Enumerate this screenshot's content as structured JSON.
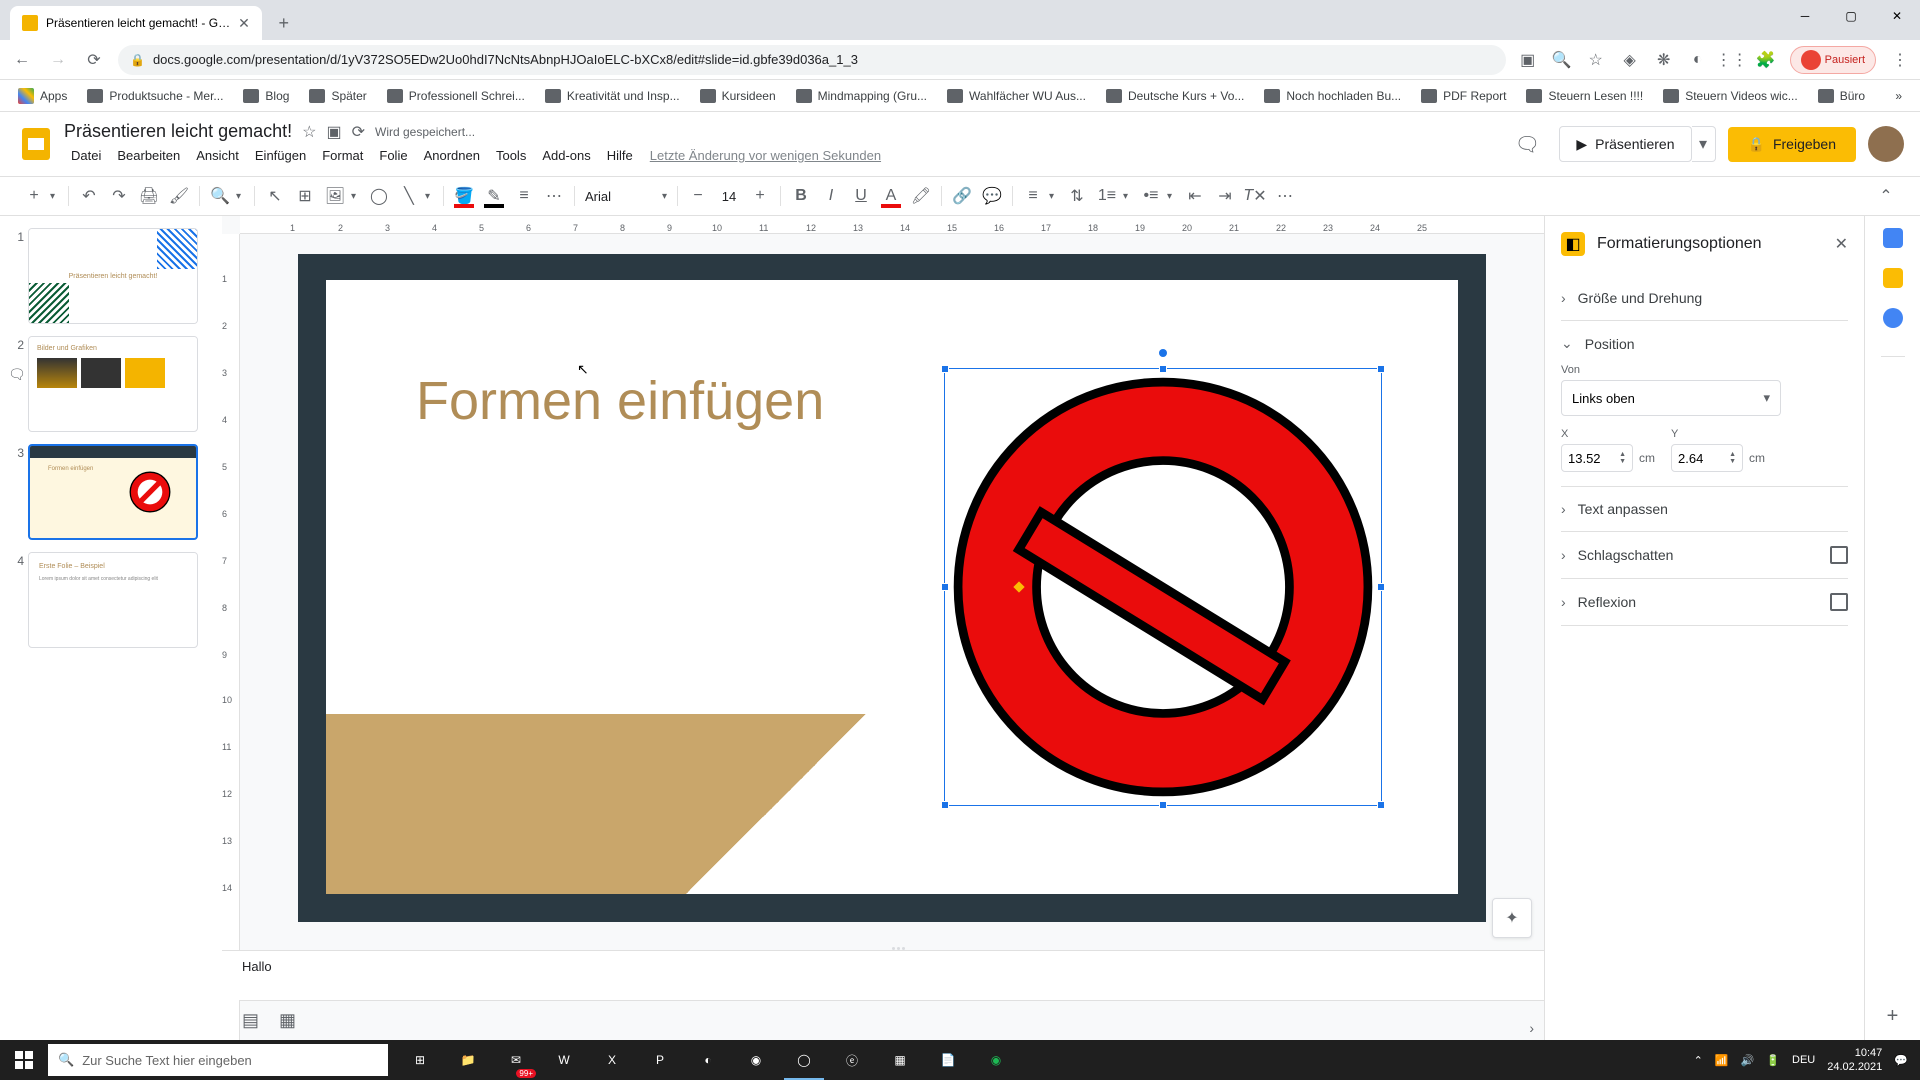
{
  "browser": {
    "tab_title": "Präsentieren leicht gemacht! - G…",
    "url": "docs.google.com/presentation/d/1yV372SO5EDw2Uo0hdI7NcNtsAbnpHJOaIoELC-bXCx8/edit#slide=id.gbfe39d036a_1_3",
    "paused": "Pausiert"
  },
  "bookmarks": [
    "Apps",
    "Produktsuche - Mer...",
    "Blog",
    "Später",
    "Professionell Schrei...",
    "Kreativität und Insp...",
    "Kursideen",
    "Mindmapping (Gru...",
    "Wahlfächer WU Aus...",
    "Deutsche Kurs + Vo...",
    "Noch hochladen Bu...",
    "PDF Report",
    "Steuern Lesen !!!!",
    "Steuern Videos wic...",
    "Büro"
  ],
  "doc": {
    "title": "Präsentieren leicht gemacht!",
    "saving": "Wird gespeichert...",
    "last_edit": "Letzte Änderung vor wenigen Sekunden"
  },
  "menu": [
    "Datei",
    "Bearbeiten",
    "Ansicht",
    "Einfügen",
    "Format",
    "Folie",
    "Anordnen",
    "Tools",
    "Add-ons",
    "Hilfe"
  ],
  "header": {
    "present": "Präsentieren",
    "share": "Freigeben"
  },
  "toolbar": {
    "font": "Arial",
    "font_size": "14"
  },
  "ruler_h": [
    "1",
    "2",
    "3",
    "4",
    "5",
    "6",
    "7",
    "8",
    "9",
    "10",
    "11",
    "12",
    "13",
    "14",
    "15",
    "16",
    "17",
    "18",
    "19",
    "20",
    "21",
    "22",
    "23",
    "24",
    "25"
  ],
  "ruler_v": [
    "1",
    "2",
    "3",
    "4",
    "5",
    "6",
    "7",
    "8",
    "9",
    "10",
    "11",
    "12",
    "13",
    "14"
  ],
  "slides": {
    "s1": {
      "num": "1",
      "title": "Präsentieren leicht gemacht!"
    },
    "s2": {
      "num": "2",
      "title": "Bilder und Grafiken"
    },
    "s3": {
      "num": "3",
      "title": "Formen einfügen"
    },
    "s4": {
      "num": "4",
      "title": "Erste Folie – Beispiel",
      "text": "Lorem ipsum dolor sit amet consectetur adipiscing elit"
    }
  },
  "canvas": {
    "title": "Formen einfügen"
  },
  "notes": "Hallo",
  "format": {
    "title": "Formatierungsoptionen",
    "size": "Größe und Drehung",
    "position": "Position",
    "from_label": "Von",
    "from_value": "Links oben",
    "x_label": "X",
    "x_value": "13.52",
    "x_unit": "cm",
    "y_label": "Y",
    "y_value": "2.64",
    "y_unit": "cm",
    "text": "Text anpassen",
    "shadow": "Schlagschatten",
    "reflection": "Reflexion"
  },
  "taskbar": {
    "search_placeholder": "Zur Suche Text hier eingeben",
    "badge": "99+",
    "lang": "DEU",
    "time": "10:47",
    "date": "24.02.2021"
  }
}
